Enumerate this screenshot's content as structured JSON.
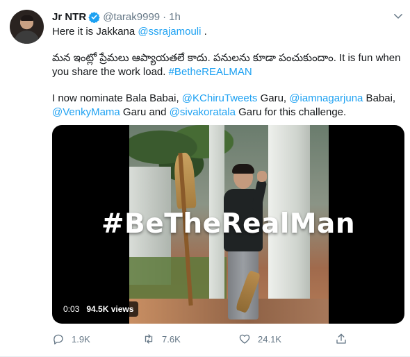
{
  "tweet": {
    "author_name": "Jr NTR",
    "handle": "@tarak9999",
    "separator": "·",
    "time": "1h",
    "line1_text": "Here it is Jakkana ",
    "line1_mention": "@ssrajamouli",
    "line1_end": " .",
    "line2_text": "మన ఇంట్లో ప్రేమలు ఆప్యాయతలే కాదు. పనులను కూడా పంచుకుందాం. It is fun when you share the work load. ",
    "line2_hashtag": "#BetheREALMAN",
    "line3_a": "I now nominate Bala Babai, ",
    "line3_m1": "@KChiruTweets",
    "line3_b": " Garu, ",
    "line3_m2": "@iamnagarjuna",
    "line3_c": " Babai, ",
    "line3_m3": "@VenkyMama",
    "line3_d": " Garu and ",
    "line3_m4": "@sivakoratala",
    "line3_e": " Garu for this challenge."
  },
  "media": {
    "overlay_text": "#BeTheRealMan",
    "duration": "0:03",
    "views": "94.5K views"
  },
  "actions": {
    "reply_icon": "reply-icon",
    "reply_count": "1.9K",
    "retweet_icon": "retweet-icon",
    "retweet_count": "7.6K",
    "like_icon": "heart-icon",
    "like_count": "24.1K",
    "share_icon": "share-icon"
  },
  "colors": {
    "link": "#1da1f2",
    "muted": "#657786",
    "verified": "#1da1f2"
  }
}
